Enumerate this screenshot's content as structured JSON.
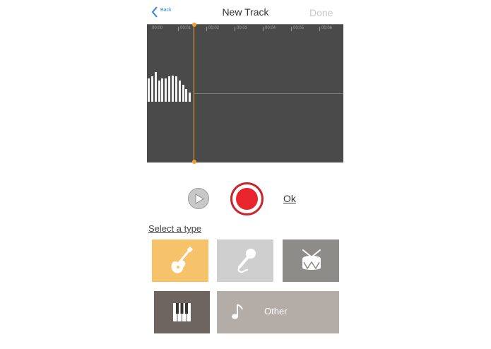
{
  "header": {
    "back_label": "Back",
    "title": "New Track",
    "done_label": "Done"
  },
  "timeline": {
    "ticks": [
      "00:00",
      "00:01",
      "00:02",
      "00:03",
      "00:04",
      "00:05",
      "00:06"
    ],
    "playhead_time_fraction": 0.22
  },
  "waveform": {
    "amplitudes": [
      0.55,
      0.6,
      0.7,
      0.5,
      0.55,
      0.55,
      0.6,
      0.62,
      0.6,
      0.5,
      0.4,
      0.3,
      0.22
    ]
  },
  "controls": {
    "play_icon": "play-icon",
    "record_icon": "record-icon",
    "ok_label": "Ok"
  },
  "type_section": {
    "label": "Select a type",
    "tiles": [
      {
        "icon": "guitar-icon",
        "color": "#f7c36a"
      },
      {
        "icon": "microphone-icon",
        "color": "#cfcfcf"
      },
      {
        "icon": "drum-icon",
        "color": "#8e8c88"
      },
      {
        "icon": "piano-icon",
        "color": "#6e6560"
      },
      {
        "icon": "music-note-icon",
        "color": "#b4aca6",
        "label": "Other"
      }
    ]
  },
  "colors": {
    "accent_blue": "#2f86d6",
    "playhead": "#f0a030",
    "record_red": "#e8242c",
    "waveform_bg": "#4a4a4a"
  }
}
